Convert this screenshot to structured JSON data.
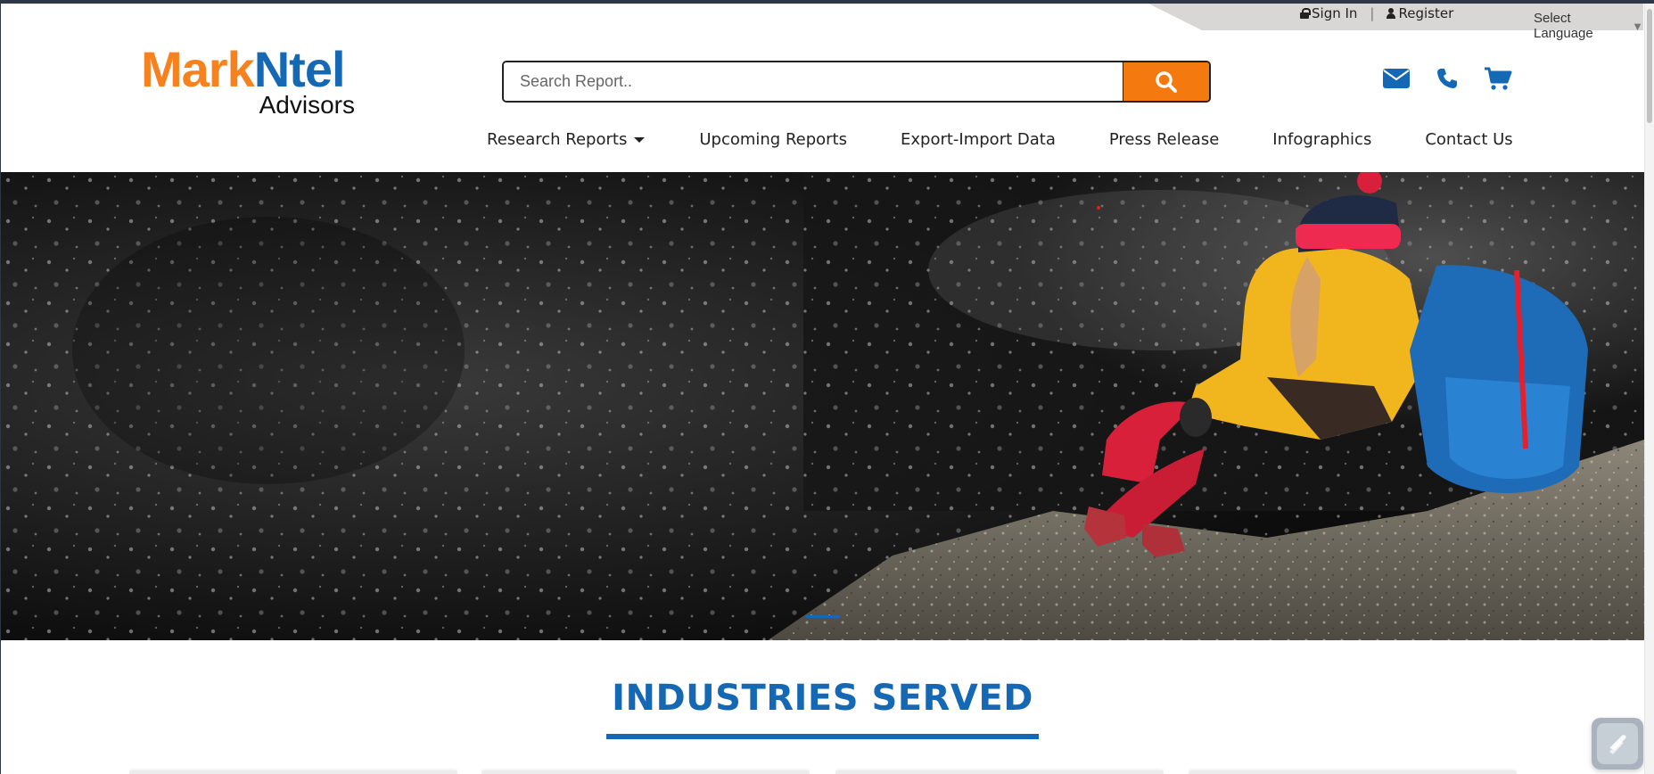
{
  "topbar": {
    "sign_in": "Sign In",
    "separator": "|",
    "register": "Register",
    "language": "Select Language",
    "language_caret": "▼"
  },
  "logo": {
    "part1": "Mark",
    "part2": "Ntel",
    "part3": "Advisors"
  },
  "search": {
    "placeholder": "Search Report.."
  },
  "nav": {
    "items": [
      {
        "label": "Research Reports"
      },
      {
        "label": "Upcoming Reports"
      },
      {
        "label": "Export-Import Data"
      },
      {
        "label": "Press Release"
      },
      {
        "label": "Infographics"
      },
      {
        "label": "Contact Us"
      }
    ]
  },
  "section": {
    "title": "INDUSTRIES SERVED"
  },
  "icons": {
    "email": "envelope-icon",
    "phone": "phone-icon",
    "cart": "cart-icon",
    "search": "search-icon",
    "chat": "chat-widget-icon"
  },
  "colors": {
    "brand_blue": "#1569b4",
    "brand_orange": "#f47a10",
    "topbar_gray": "#d9d6d6"
  }
}
